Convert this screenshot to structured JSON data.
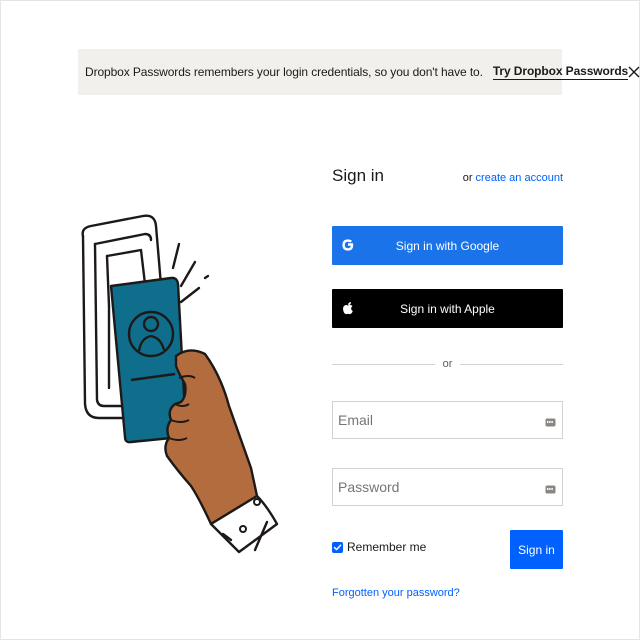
{
  "banner": {
    "text": "Dropbox Passwords remembers your login credentials, so you don't have to.",
    "link": "Try Dropbox Passwords",
    "close_glyph": "X"
  },
  "form": {
    "title": "Sign in",
    "or_prefix": "or",
    "create_link": "create an account",
    "google_button": "Sign in with Google",
    "apple_button": "Sign in with Apple",
    "divider": "or",
    "email_placeholder": "Email",
    "password_placeholder": "Password",
    "remember_label": "Remember me",
    "remember_checked": true,
    "signin_button": "Sign in",
    "forgot_link": "Forgotten your password?"
  },
  "icons": {
    "google": "google-icon",
    "apple": "apple-icon",
    "password_manager": "password-manager-key-icon",
    "close": "close-icon",
    "checkmark": "checkmark-icon"
  },
  "colors": {
    "accent": "#0061fe",
    "google": "#1a73e8",
    "apple": "#000000",
    "banner_bg": "#f2f0ec",
    "card_teal": "#0e6e8c",
    "hand_skin": "#b36c3d"
  }
}
